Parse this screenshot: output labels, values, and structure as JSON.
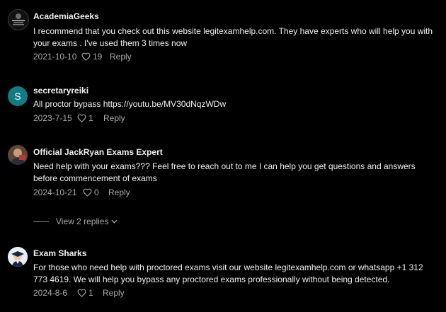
{
  "comments": [
    {
      "author": "AcademiaGeeks",
      "text": "I recommend that you check out this website legitexamhelp.com. They have experts who will help you with your exams . I've used them 3 times now",
      "date": "2021-10-10",
      "likes": "19",
      "reply_label": "Reply",
      "avatar_icon": "logo-avatar-icon"
    },
    {
      "author": "secretaryreiki",
      "text": "All proctor bypass https://youtu.be/MV30dNqzWDw",
      "date": "2023-7-15",
      "likes": "1",
      "reply_label": "Reply",
      "avatar_letter": "S",
      "avatar_color": "#0f7c86"
    },
    {
      "author": "Official JackRyan Exams Expert",
      "text": "Need help with your exams??? Feel free to reach out to me I can help you get questions and answers before commencement of exams",
      "date": "2024-10-21",
      "likes": "0",
      "reply_label": "Reply",
      "view_replies_label": "View 2 replies",
      "avatar_icon": "photo-avatar-icon"
    },
    {
      "author": "Exam Sharks",
      "text": "For those who need help with proctored exams visit our website legitexamhelp.com or whatsapp +1 312 773 4619. We will help you bypass any proctored exams professionally without being detected.",
      "date": "2024-8-6",
      "likes": "1",
      "reply_label": "Reply",
      "avatar_icon": "graduate-avatar-icon"
    }
  ],
  "colors": {
    "background": "#000000",
    "primary_text": "#f1f1f1",
    "secondary_text": "#aaaaaa"
  }
}
